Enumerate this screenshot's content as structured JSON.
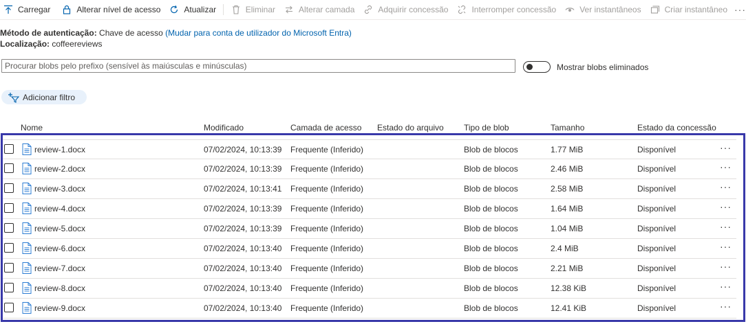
{
  "toolbar": {
    "items": [
      {
        "label": "Carregar",
        "icon": "upload-icon",
        "enabled": true
      },
      {
        "label": "Alterar nível de acesso",
        "icon": "lock-icon",
        "enabled": true
      },
      {
        "label": "Atualizar",
        "icon": "refresh-icon",
        "enabled": true
      },
      {
        "label": "Eliminar",
        "icon": "trash-icon",
        "enabled": false
      },
      {
        "label": "Alterar camada",
        "icon": "swap-icon",
        "enabled": false
      },
      {
        "label": "Adquirir concessão",
        "icon": "link-icon",
        "enabled": false
      },
      {
        "label": "Interromper concessão",
        "icon": "broken-link-icon",
        "enabled": false
      },
      {
        "label": "Ver instantâneos",
        "icon": "eye-icon",
        "enabled": false
      },
      {
        "label": "Criar instantâneo",
        "icon": "snapshot-icon",
        "enabled": false
      }
    ],
    "more": "···"
  },
  "auth": {
    "label": "Método de autenticação:",
    "value": "Chave de acesso",
    "link": "(Mudar para conta de utilizador do Microsoft Entra)"
  },
  "location": {
    "label": "Localização:",
    "value": "coffeereviews"
  },
  "search": {
    "placeholder": "Procurar blobs pelo prefixo (sensível às maiúsculas e minúsculas)"
  },
  "toggle": {
    "label": "Mostrar blobs eliminados",
    "on": false
  },
  "filter": {
    "label": "Adicionar filtro"
  },
  "table": {
    "columns": [
      "Nome",
      "Modificado",
      "Camada de acesso",
      "Estado do arquivo",
      "Tipo de blob",
      "Tamanho",
      "Estado da concessão"
    ],
    "rows": [
      {
        "name": "review-1.docx",
        "modified": "07/02/2024, 10:13:39",
        "tier": "Frequente (Inferido)",
        "archive": "",
        "type": "Blob de blocos",
        "size": "1.77 MiB",
        "lease": "Disponível"
      },
      {
        "name": "review-2.docx",
        "modified": "07/02/2024, 10:13:39",
        "tier": "Frequente (Inferido)",
        "archive": "",
        "type": "Blob de blocos",
        "size": "2.46 MiB",
        "lease": "Disponível"
      },
      {
        "name": "review-3.docx",
        "modified": "07/02/2024, 10:13:41",
        "tier": "Frequente (Inferido)",
        "archive": "",
        "type": "Blob de blocos",
        "size": "2.58 MiB",
        "lease": "Disponível"
      },
      {
        "name": "review-4.docx",
        "modified": "07/02/2024, 10:13:39",
        "tier": "Frequente (Inferido)",
        "archive": "",
        "type": "Blob de blocos",
        "size": "1.64 MiB",
        "lease": "Disponível"
      },
      {
        "name": "review-5.docx",
        "modified": "07/02/2024, 10:13:39",
        "tier": "Frequente (Inferido)",
        "archive": "",
        "type": "Blob de blocos",
        "size": "1.04 MiB",
        "lease": "Disponível"
      },
      {
        "name": "review-6.docx",
        "modified": "07/02/2024, 10:13:40",
        "tier": "Frequente (Inferido)",
        "archive": "",
        "type": "Blob de blocos",
        "size": "2.4 MiB",
        "lease": "Disponível"
      },
      {
        "name": "review-7.docx",
        "modified": "07/02/2024, 10:13:40",
        "tier": "Frequente (Inferido)",
        "archive": "",
        "type": "Blob de blocos",
        "size": "2.21 MiB",
        "lease": "Disponível"
      },
      {
        "name": "review-8.docx",
        "modified": "07/02/2024, 10:13:40",
        "tier": "Frequente (Inferido)",
        "archive": "",
        "type": "Blob de blocos",
        "size": "12.38 KiB",
        "lease": "Disponível"
      },
      {
        "name": "review-9.docx",
        "modified": "07/02/2024, 10:13:40",
        "tier": "Frequente (Inferido)",
        "archive": "",
        "type": "Blob de blocos",
        "size": "12.41 KiB",
        "lease": "Disponível"
      }
    ],
    "row_more": "···"
  },
  "colors": {
    "link": "#0062ad",
    "disabled": "#a19f9d",
    "selection_frame": "#3838a9",
    "file_icon": "#2b7cd3",
    "filter_bg": "#e8f1fb"
  }
}
